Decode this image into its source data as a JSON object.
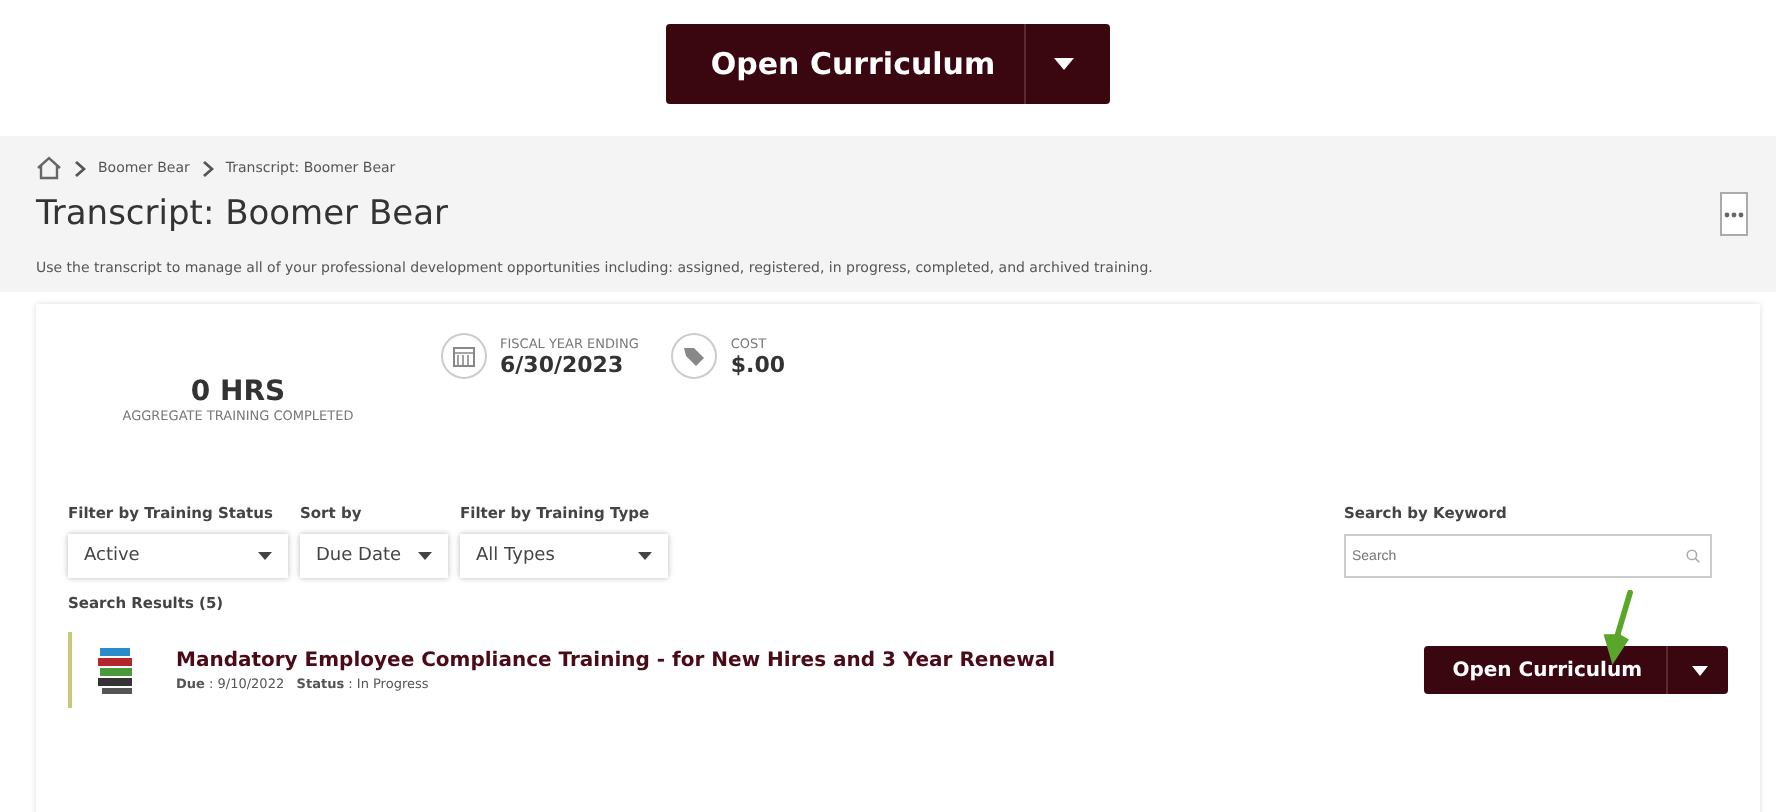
{
  "hero_button": {
    "label": "Open Curriculum"
  },
  "breadcrumb": [
    "Boomer Bear",
    "Transcript: Boomer Bear"
  ],
  "page_title": "Transcript: Boomer Bear",
  "description": "Use the transcript to manage all of your professional development opportunities including: assigned, registered, in progress, completed, and archived training.",
  "summary": {
    "hours": "0 HRS",
    "hours_label": "AGGREGATE TRAINING COMPLETED",
    "fiscal_label": "FISCAL YEAR ENDING",
    "fiscal_value": "6/30/2023",
    "cost_label": "COST",
    "cost_value": "$.00"
  },
  "filters": [
    {
      "label": "Filter by Training Status",
      "value": "Active"
    },
    {
      "label": "Sort by",
      "value": "Due Date"
    },
    {
      "label": "Filter by Training Type",
      "value": "All Types"
    }
  ],
  "search": {
    "label": "Search by Keyword",
    "placeholder": "Search"
  },
  "results_label": "Search Results (5)",
  "results": [
    {
      "title": "Mandatory Employee Compliance Training - for New Hires and 3 Year Renewal",
      "meta": "**Due** : 9/10/2022   **Status** : In Progress",
      "button": "Open Curriculum"
    }
  ]
}
